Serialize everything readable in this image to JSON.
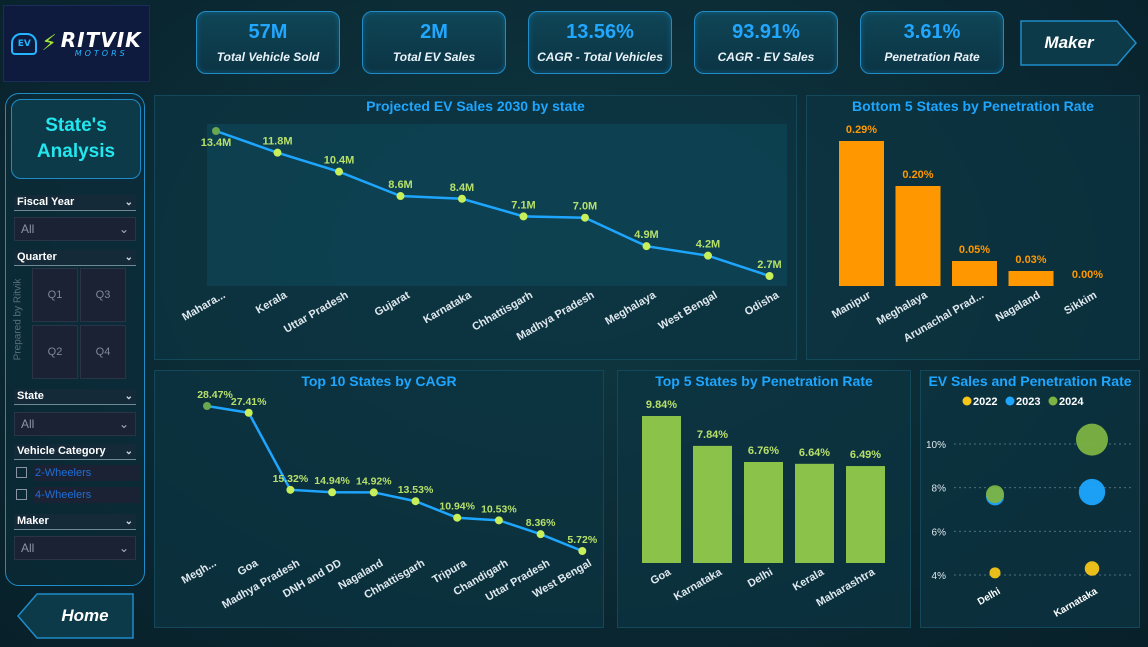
{
  "logo": {
    "badge": "EV",
    "name": "RITVIK",
    "sub": "MOTORS"
  },
  "kpis": [
    {
      "value": "57M",
      "label": "Total Vehicle Sold"
    },
    {
      "value": "2M",
      "label": "Total EV Sales"
    },
    {
      "value": "13.56%",
      "label": "CAGR - Total Vehicles"
    },
    {
      "value": "93.91%",
      "label": "CAGR - EV Sales"
    },
    {
      "value": "3.61%",
      "label": "Penetration Rate"
    }
  ],
  "nav": {
    "maker": "Maker",
    "home": "Home"
  },
  "sidebar": {
    "title_line1": "State's",
    "title_line2": "Analysis",
    "prepared_by": "Prepared by Ritvik",
    "filters": {
      "fiscal_year": {
        "label": "Fiscal Year",
        "value": "All"
      },
      "quarter": {
        "label": "Quarter",
        "options": [
          "Q1",
          "Q3",
          "Q2",
          "Q4"
        ]
      },
      "state": {
        "label": "State",
        "value": "All"
      },
      "vehicle_category": {
        "label": "Vehicle Category",
        "options": [
          "2-Wheelers",
          "4-Wheelers"
        ]
      },
      "maker": {
        "label": "Maker",
        "value": "All"
      }
    }
  },
  "colors": {
    "accent": "#1ea6ff",
    "line": "#1ea6ff",
    "green": "#8bc34a",
    "orange": "#ff9800",
    "yellow": "#f5c518",
    "y2022": "#f5c518",
    "y2023": "#1ea6ff",
    "y2024": "#7cb342"
  },
  "chart_data": [
    {
      "id": "projected",
      "type": "line",
      "title": "Projected EV Sales 2030 by state",
      "categories": [
        "Mahara...",
        "Kerala",
        "Uttar Pradesh",
        "Gujarat",
        "Karnataka",
        "Chhattisgarh",
        "Madhya Pradesh",
        "Meghalaya",
        "West Bengal",
        "Odisha"
      ],
      "values": [
        13.4,
        11.8,
        10.4,
        8.6,
        8.4,
        7.1,
        7.0,
        4.9,
        4.2,
        2.7
      ],
      "labels": [
        "13.4M",
        "11.8M",
        "10.4M",
        "8.6M",
        "8.4M",
        "7.1M",
        "7.0M",
        "4.9M",
        "4.2M",
        "2.7M"
      ]
    },
    {
      "id": "bottom5",
      "type": "bar",
      "title": "Bottom 5 States by Penetration Rate",
      "categories": [
        "Manipur",
        "Meghalaya",
        "Arunachal Prad...",
        "Nagaland",
        "Sikkim"
      ],
      "values": [
        0.29,
        0.2,
        0.05,
        0.03,
        0.0
      ],
      "labels": [
        "0.29%",
        "0.20%",
        "0.05%",
        "0.03%",
        "0.00%"
      ]
    },
    {
      "id": "cagr",
      "type": "line",
      "title": "Top 10 States by CAGR",
      "categories": [
        "Megh...",
        "Goa",
        "Madhya Pradesh",
        "DNH and DD",
        "Nagaland",
        "Chhattisgarh",
        "Tripura",
        "Chandigarh",
        "Uttar Pradesh",
        "West Bengal"
      ],
      "values": [
        28.47,
        27.41,
        15.32,
        14.94,
        14.92,
        13.53,
        10.94,
        10.53,
        8.36,
        5.72
      ],
      "labels": [
        "28.47%",
        "27.41%",
        "15.32%",
        "14.94%",
        "14.92%",
        "13.53%",
        "10.94%",
        "10.53%",
        "8.36%",
        "5.72%"
      ]
    },
    {
      "id": "top5",
      "type": "bar",
      "title": "Top 5 States by Penetration Rate",
      "categories": [
        "Goa",
        "Karnataka",
        "Delhi",
        "Kerala",
        "Maharashtra"
      ],
      "values": [
        9.84,
        7.84,
        6.76,
        6.64,
        6.49
      ],
      "labels": [
        "9.84%",
        "7.84%",
        "6.76%",
        "6.64%",
        "6.49%"
      ]
    },
    {
      "id": "bubble",
      "type": "scatter",
      "title": "EV Sales and Penetration Rate",
      "legend": [
        "2022",
        "2023",
        "2024"
      ],
      "categories": [
        "Delhi",
        "Karnataka"
      ],
      "yticks": [
        "10%",
        "8%",
        "6%",
        "4%"
      ],
      "ylim": [
        4,
        10
      ],
      "points": [
        {
          "state": "Delhi",
          "year": "2022",
          "y": 4.1,
          "size": 1
        },
        {
          "state": "Delhi",
          "year": "2023",
          "y": 7.6,
          "size": 2
        },
        {
          "state": "Delhi",
          "year": "2024",
          "y": 7.7,
          "size": 2
        },
        {
          "state": "Karnataka",
          "year": "2022",
          "y": 4.3,
          "size": 1.5
        },
        {
          "state": "Karnataka",
          "year": "2023",
          "y": 7.8,
          "size": 3.2
        },
        {
          "state": "Karnataka",
          "year": "2024",
          "y": 10.2,
          "size": 4
        }
      ]
    }
  ]
}
